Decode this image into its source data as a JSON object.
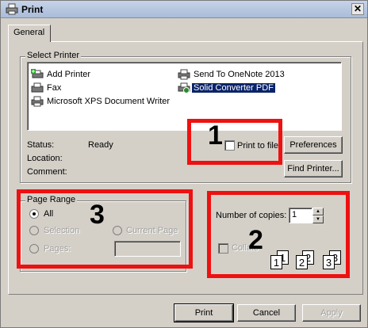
{
  "window": {
    "title": "Print",
    "close_glyph": "✕"
  },
  "tabs": [
    {
      "label": "General"
    }
  ],
  "select_printer": {
    "legend": "Select Printer",
    "printers": [
      {
        "name": "Add Printer",
        "icon": "add-printer-icon",
        "selected": false
      },
      {
        "name": "Fax",
        "icon": "fax-icon",
        "selected": false
      },
      {
        "name": "Microsoft XPS Document Writer",
        "icon": "printer-icon",
        "selected": false
      },
      {
        "name": "Send To OneNote 2013",
        "icon": "printer-icon",
        "selected": false
      },
      {
        "name": "Solid Converter PDF",
        "icon": "printer-icon",
        "selected": true
      }
    ],
    "status_label": "Status:",
    "status_value": "Ready",
    "location_label": "Location:",
    "location_value": "",
    "comment_label": "Comment:",
    "comment_value": "",
    "print_to_file_label": "Print to file",
    "preferences_label": "Preferences",
    "find_printer_label": "Find Printer..."
  },
  "page_range": {
    "legend": "Page Range",
    "all_label": "All",
    "selection_label": "Selection",
    "current_page_label": "Current Page",
    "pages_label": "Pages:",
    "pages_value": ""
  },
  "copies": {
    "number_label": "Number of copies:",
    "number_value": "1",
    "collate_label": "Collate",
    "collate_pages": [
      "1",
      "1",
      "2",
      "2",
      "3",
      "3"
    ]
  },
  "annotations": [
    "1",
    "2",
    "3"
  ],
  "buttons": {
    "print": "Print",
    "cancel": "Cancel",
    "apply": "Apply"
  },
  "colors": {
    "annotation_red": "#e11111",
    "selection_blue": "#0a246a",
    "dialog_bg": "#d4d0c8"
  }
}
